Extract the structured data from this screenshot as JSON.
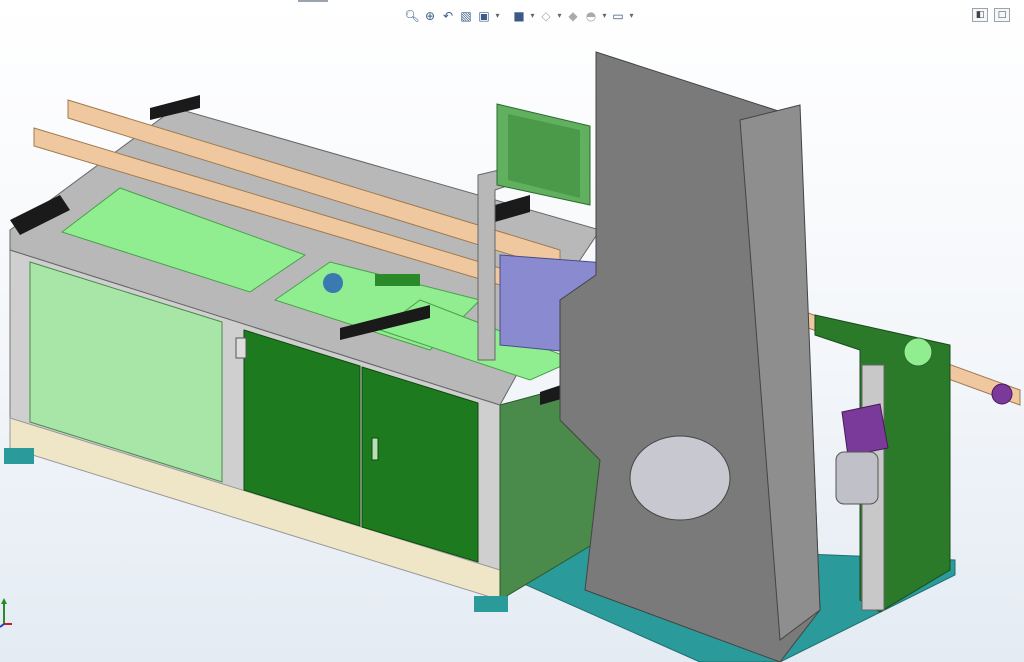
{
  "app": {
    "view": "3D model viewport",
    "background": "#f0f4f8"
  },
  "heads_up_toolbar": {
    "buttons": [
      {
        "icon": "zoom-to-fit-icon"
      },
      {
        "icon": "zoom-to-area-icon"
      },
      {
        "icon": "previous-view-icon"
      },
      {
        "icon": "section-view-icon"
      },
      {
        "icon": "view-orientation-icon",
        "dropdown": true
      },
      {
        "icon": "display-style-icon",
        "dropdown": true
      },
      {
        "icon": "hide-show-items-icon",
        "dropdown": true
      },
      {
        "icon": "edit-appearance-icon",
        "dropdown": true
      },
      {
        "icon": "apply-scene-icon",
        "dropdown": true
      },
      {
        "icon": "view-settings-icon",
        "dropdown": true
      }
    ]
  },
  "window_controls": [
    {
      "icon": "tile-left-icon"
    },
    {
      "icon": "maximize-icon"
    }
  ],
  "model": {
    "colors": {
      "frame": "#c8c8c8",
      "panel_light_green": "#a8e6a8",
      "panel_dark_green": "#1e7a1e",
      "bed_green": "#90ee90",
      "wood_rail": "#f0c8a0",
      "column_gray": "#7a7a7a",
      "base_teal": "#2a9a9a",
      "base_cream": "#efe6c8",
      "accent_purple": "#7a3a9a",
      "mechanism_blue": "#8a8ad0",
      "black_block": "#1a1a1a",
      "monitor_green": "#60b060"
    }
  },
  "triad": {
    "icon": "coordinate-triad-icon"
  }
}
